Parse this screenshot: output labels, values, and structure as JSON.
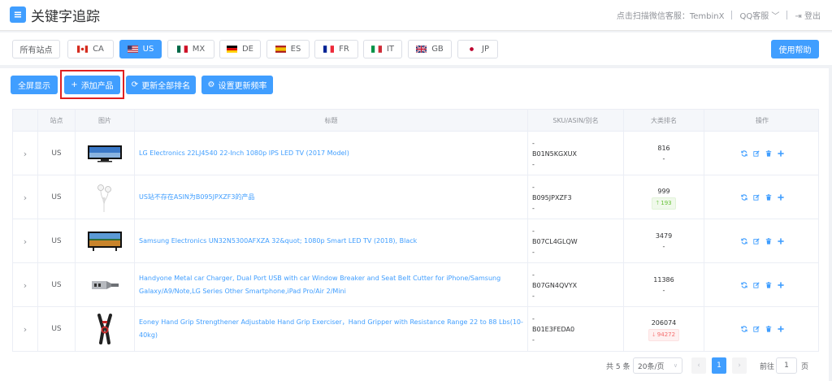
{
  "header": {
    "title": "关键字追踪",
    "contact_label": "点击扫描微信客服：TembinX",
    "qq_label": "QQ客服",
    "logout_label": "登出"
  },
  "sites": {
    "all_label": "所有站点",
    "items": [
      {
        "code": "CA",
        "flag": "ca-flag-icon"
      },
      {
        "code": "US",
        "flag": "us-flag-icon",
        "active": true
      },
      {
        "code": "MX",
        "flag": "mx-flag-icon"
      },
      {
        "code": "DE",
        "flag": "de-flag-icon"
      },
      {
        "code": "ES",
        "flag": "es-flag-icon"
      },
      {
        "code": "FR",
        "flag": "fr-flag-icon"
      },
      {
        "code": "IT",
        "flag": "it-flag-icon"
      },
      {
        "code": "GB",
        "flag": "gb-flag-icon"
      },
      {
        "code": "JP",
        "flag": "jp-flag-icon"
      }
    ],
    "help_label": "使用帮助"
  },
  "toolbar": {
    "fullscreen_label": "全屏显示",
    "add_label": "添加产品",
    "refresh_label": "更新全部排名",
    "frequency_label": "设置更新频率"
  },
  "table": {
    "columns": {
      "site": "站点",
      "image": "图片",
      "title": "标题",
      "sku": "SKU/ASIN/别名",
      "rank": "大类排名",
      "actions": "操作"
    },
    "rows": [
      {
        "site": "US",
        "image": "tv-thumbnail",
        "title": "LG Electronics 22LJ4540 22-Inch 1080p IPS LED TV (2017 Model)",
        "sku_top": "-",
        "asin": "B01N5KGXUX",
        "sku_bottom": "-",
        "rank": "816",
        "rank_change": "-",
        "change_dir": "none"
      },
      {
        "site": "US",
        "image": "earphones-thumbnail",
        "title": "US站不存在ASIN为B095JPXZF3的产品",
        "sku_top": "-",
        "asin": "B095JPXZF3",
        "sku_bottom": "-",
        "rank": "999",
        "rank_change": "193",
        "change_dir": "up"
      },
      {
        "site": "US",
        "image": "tv-thumbnail",
        "title": "Samsung Electronics UN32N5300AFXZA 32&quot; 1080p Smart LED TV (2018), Black",
        "sku_top": "-",
        "asin": "B07CL4GLQW",
        "sku_bottom": "-",
        "rank": "3479",
        "rank_change": "-",
        "change_dir": "none"
      },
      {
        "site": "US",
        "image": "charger-thumbnail",
        "title": "Handyone Metal car Charger, Dual Port USB with car Window Breaker and Seat Belt Cutter for iPhone/Samsung Galaxy/A9/Note,LG Series Other Smartphone,iPad Pro/Air 2/Mini",
        "sku_top": "-",
        "asin": "B07GN4QVYX",
        "sku_bottom": "-",
        "rank": "11386",
        "rank_change": "-",
        "change_dir": "none"
      },
      {
        "site": "US",
        "image": "hand-grip-thumbnail",
        "title": "Eoney Hand Grip Strengthener Adjustable Hand Grip Exerciser，Hand Gripper with Resistance Range 22 to 88 Lbs(10-40kg)",
        "sku_top": "-",
        "asin": "B01E3FEDA0",
        "sku_bottom": "-",
        "rank": "206074",
        "rank_change": "94272",
        "change_dir": "down"
      }
    ]
  },
  "pagination": {
    "total_label": "共 5 条",
    "page_size": "20条/页",
    "current_page": "1",
    "goto_label": "前往",
    "goto_value": "1",
    "page_suffix": "页"
  },
  "colors": {
    "primary": "#409eff",
    "up": "#67c23a",
    "down": "#f56c6c",
    "highlight": "#e02020"
  }
}
